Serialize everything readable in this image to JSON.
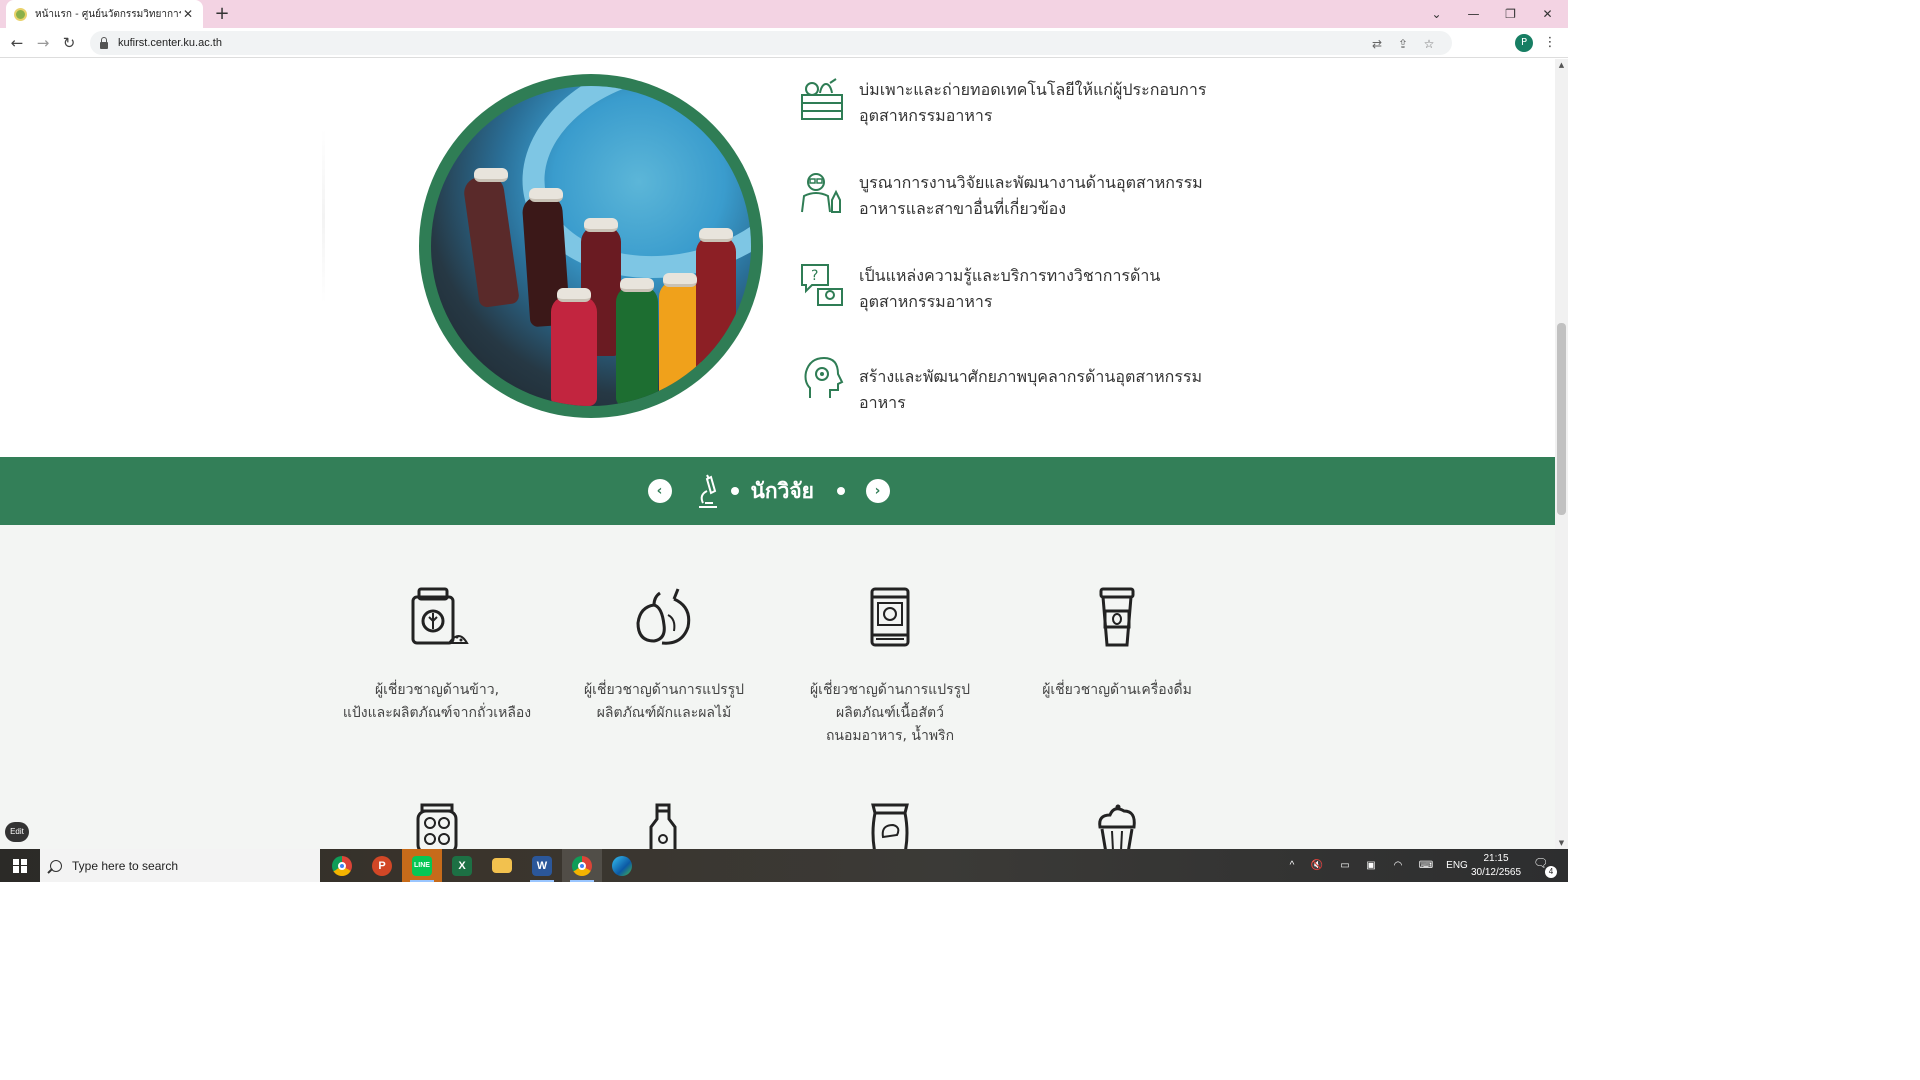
{
  "browser": {
    "tab_title": "หน้าแรก - ศูนย์นวัตกรรมวิทยาการอาหาร",
    "url": "kufirst.center.ku.ac.th",
    "profile_initial": "P"
  },
  "missions": [
    {
      "icon": "produce-crate-icon",
      "text": "บ่มเพาะและถ่ายทอดเทคโนโลยีให้แก่ผู้ประกอบการอุตสาหกรรมอาหาร"
    },
    {
      "icon": "researcher-icon",
      "text": "บูรณาการงานวิจัยและพัฒนางานด้านอุตสาหกรรมอาหารและสาขาอื่นที่เกี่ยวข้อง"
    },
    {
      "icon": "knowledge-chat-icon",
      "text": "เป็นแหล่งความรู้และบริการทางวิชาการด้านอุตสาหกรรมอาหาร"
    },
    {
      "icon": "head-gear-icon",
      "text": "สร้างและพัฒนาศักยภาพบุคลากรด้านอุตสาหกรรมอาหาร"
    }
  ],
  "researcher_band": {
    "title": "นักวิจัย",
    "prev_icon": "chevron-left-icon",
    "next_icon": "chevron-right-icon",
    "icon": "microscope-icon"
  },
  "experts": [
    {
      "icon": "grain-jar-icon",
      "label": "ผู้เชี่ยวชาญด้านข้าว,\nแป้งและผลิตภัณฑ์จากถั่วเหลือง"
    },
    {
      "icon": "fruit-vegetable-icon",
      "label": "ผู้เชี่ยวชาญด้านการแปรรูป\nผลิตภัณฑ์ผักและผลไม้"
    },
    {
      "icon": "canned-meat-icon",
      "label": "ผู้เชี่ยวชาญด้านการแปรรูป\nผลิตภัณฑ์เนื้อสัตว์\nถนอมอาหาร, น้ำพริก"
    },
    {
      "icon": "coffee-cup-icon",
      "label": "ผู้เชี่ยวชาญด้านเครื่องดื่ม"
    }
  ],
  "experts_row2_icons": [
    "pickle-jar-icon",
    "bottle-icon",
    "snack-bag-icon",
    "cupcake-icon"
  ],
  "edit_badge": "Edit",
  "taskbar": {
    "search_placeholder": "Type here to search",
    "language": "ENG",
    "time": "21:15",
    "date": "30/12/2565",
    "notification_count": "4"
  }
}
